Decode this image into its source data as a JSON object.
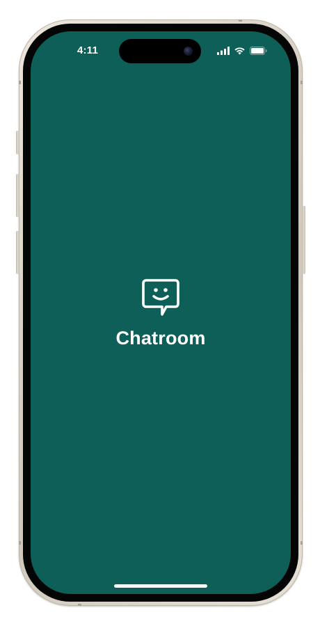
{
  "status_bar": {
    "time": "4:11",
    "icons": [
      "cellular-signal-icon",
      "wifi-icon",
      "battery-icon"
    ]
  },
  "splash": {
    "app_name": "Chatroom",
    "logo_icon": "smiley-chat-bubble-icon"
  },
  "colors": {
    "screen_background": "#0d5f58",
    "foreground": "#ffffff"
  }
}
